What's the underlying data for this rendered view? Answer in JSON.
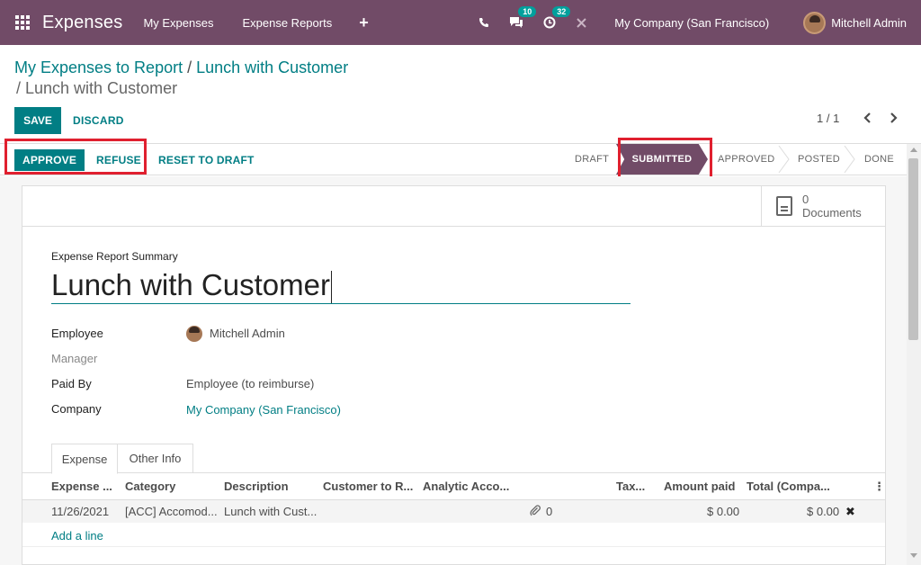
{
  "navbar": {
    "brand": "Expenses",
    "menu": [
      "My Expenses",
      "Expense Reports"
    ],
    "plus": "+",
    "messages_count": "10",
    "activities_count": "32",
    "company": "My Company (San Francisco)",
    "user": "Mitchell Admin"
  },
  "breadcrumb": {
    "parent": "My Expenses to Report",
    "sep": " / ",
    "current_inline": "Lunch with Customer",
    "line2": "/ Lunch with Customer"
  },
  "controls": {
    "save": "SAVE",
    "discard": "DISCARD",
    "pager": "1 / 1",
    "prev": "‹",
    "next": "›"
  },
  "statusbar": {
    "approve": "APPROVE",
    "refuse": "REFUSE",
    "reset": "RESET TO DRAFT",
    "stages": [
      "DRAFT",
      "SUBMITTED",
      "APPROVED",
      "POSTED",
      "DONE"
    ],
    "active_stage": "SUBMITTED"
  },
  "sheet": {
    "documents_count": "0",
    "documents_label": "Documents",
    "summary_label": "Expense Report Summary",
    "title": "Lunch with Customer",
    "fields": {
      "employee_label": "Employee",
      "employee_value": "Mitchell Admin",
      "manager_label": "Manager",
      "paid_by_label": "Paid By",
      "paid_by_value": "Employee (to reimburse)",
      "company_label": "Company",
      "company_value": "My Company (San Francisco)"
    },
    "tabs": [
      "Expense",
      "Other Info"
    ],
    "table": {
      "headers": [
        "Expense ...",
        "Category",
        "Description",
        "Customer to R...",
        "Analytic Acco...",
        "Tax...",
        "Amount paid",
        "Total (Compa..."
      ],
      "menu_icon": "⋮",
      "row": {
        "date": "11/26/2021",
        "category": "[ACC] Accomod...",
        "description": "Lunch with Cust...",
        "attachments": "0",
        "amount_paid": "$ 0.00",
        "total": "$ 0.00",
        "delete": "✖"
      },
      "add_line": "Add a line"
    }
  },
  "colors": {
    "brand": "#714b67",
    "accent": "#017e84",
    "highlight": "#e0202f"
  }
}
